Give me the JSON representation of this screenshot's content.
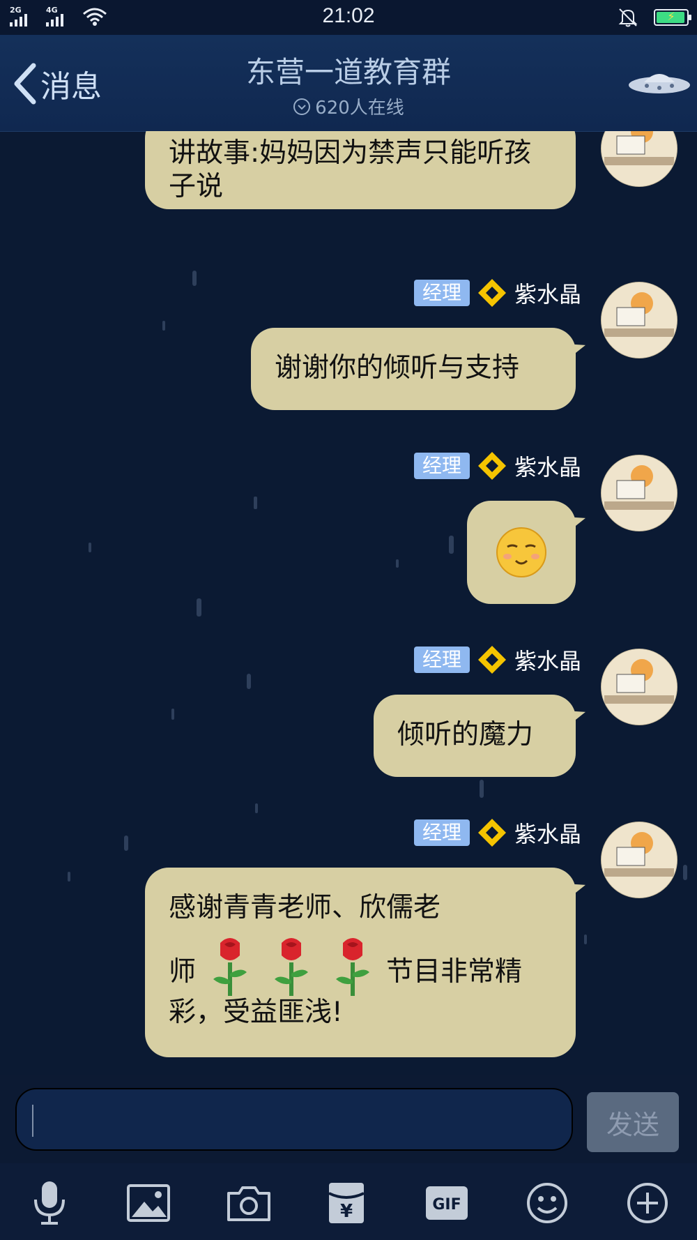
{
  "status_bar": {
    "time": "21:02",
    "net1": "2G",
    "net2": "4G"
  },
  "header": {
    "back_label": "消息",
    "title": "东营一道教育群",
    "online": "620人在线"
  },
  "messages": [
    {
      "text": "讲故事:妈妈因为禁声只能听孩子说"
    },
    {
      "badge": "经理",
      "sender": "紫水晶",
      "text": "谢谢你的倾听与支持"
    },
    {
      "badge": "经理",
      "sender": "紫水晶",
      "emoji": "smile-face"
    },
    {
      "badge": "经理",
      "sender": "紫水晶",
      "text": "倾听的魔力"
    },
    {
      "badge": "经理",
      "sender": "紫水晶",
      "text_line1": "感谢青青老师、欣儒老",
      "text_line2_a": "师",
      "text_line2_b": "节目非常精",
      "text_line3": "彩，受益匪浅!"
    }
  ],
  "input": {
    "value": "",
    "send_label": "发送"
  },
  "toolbar": {
    "items": [
      "mic-icon",
      "image-icon",
      "camera-icon",
      "red-packet-icon",
      "gif-icon",
      "emoji-icon",
      "plus-icon"
    ],
    "gif_label": "GIF",
    "red_packet_symbol": "¥"
  },
  "colors": {
    "bubble": "#d7cfa3",
    "badge": "#8fb8f0",
    "background": "#0b1a33"
  }
}
